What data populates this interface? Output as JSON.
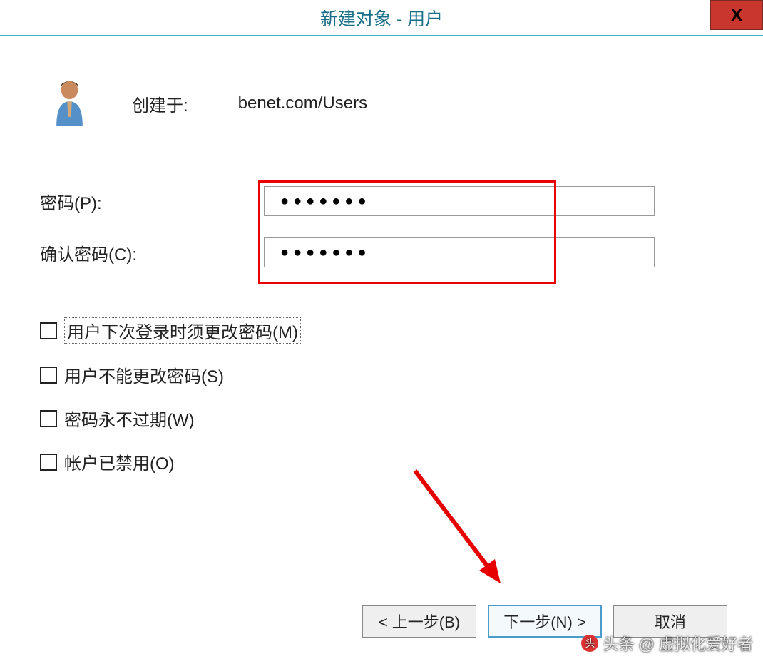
{
  "titlebar": {
    "title": "新建对象 - 用户",
    "close": "X"
  },
  "header": {
    "created_label": "创建于:",
    "created_value": "benet.com/Users"
  },
  "fields": {
    "password_label": "密码(P):",
    "password_value": "●●●●●●●",
    "confirm_label": "确认密码(C):",
    "confirm_value": "●●●●●●●"
  },
  "checkboxes": [
    {
      "label": "用户下次登录时须更改密码(M)",
      "checked": false,
      "highlighted": true
    },
    {
      "label": "用户不能更改密码(S)",
      "checked": false,
      "highlighted": false
    },
    {
      "label": "密码永不过期(W)",
      "checked": false,
      "highlighted": false
    },
    {
      "label": "帐户已禁用(O)",
      "checked": false,
      "highlighted": false
    }
  ],
  "buttons": {
    "back": "< 上一步(B)",
    "next": "下一步(N) >",
    "cancel": "取消"
  },
  "watermark": "头条 @ 虚拟化爱好者"
}
